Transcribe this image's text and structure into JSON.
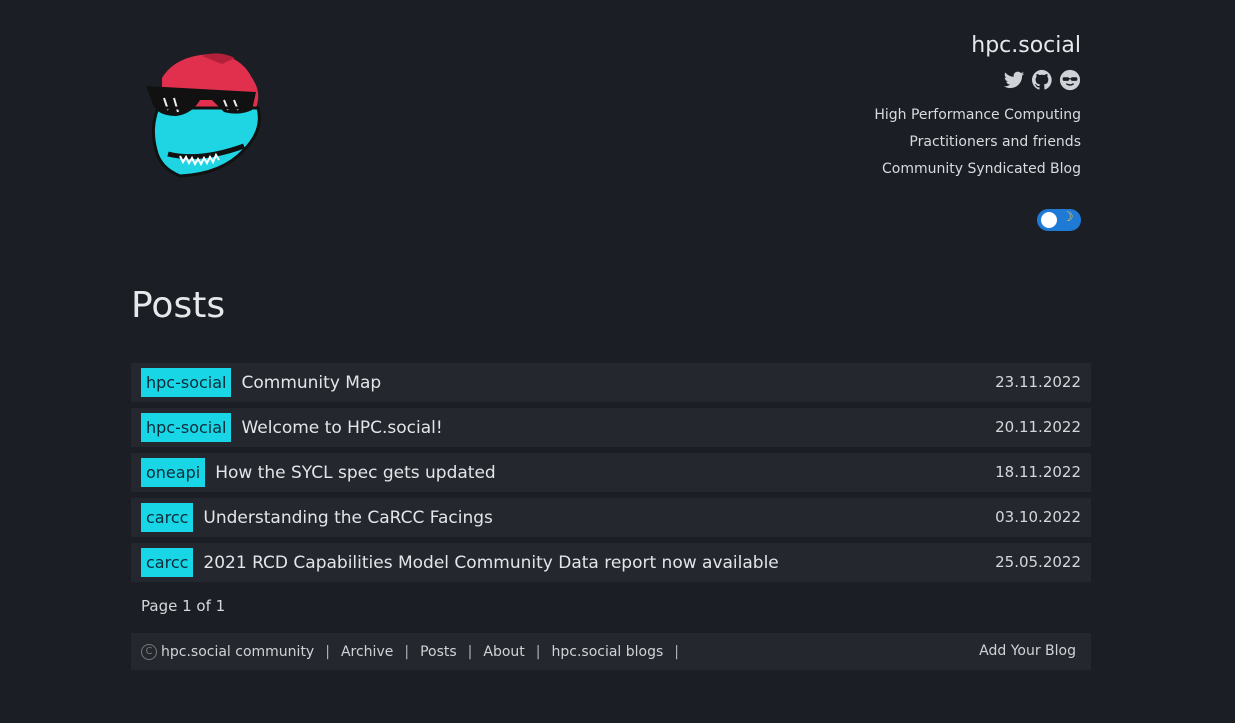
{
  "site": {
    "title": "hpc.social",
    "tagline": [
      "High Performance Computing",
      "Practitioners and friends",
      "Community Syndicated Blog"
    ],
    "social_icons": [
      "twitter-icon",
      "github-icon",
      "mastodon-icon"
    ],
    "toggle_icon": "moon-icon"
  },
  "main": {
    "heading": "Posts",
    "posts": [
      {
        "tag": "hpc-social",
        "title": "Community Map",
        "date": "23.11.2022"
      },
      {
        "tag": "hpc-social",
        "title": "Welcome to HPC.social!",
        "date": "20.11.2022"
      },
      {
        "tag": "oneapi",
        "title": "How the SYCL spec gets updated",
        "date": "18.11.2022"
      },
      {
        "tag": "carcc",
        "title": "Understanding the CaRCC Facings",
        "date": "03.10.2022"
      },
      {
        "tag": "carcc",
        "title": "2021 RCD Capabilities Model Community Data report now available",
        "date": "25.05.2022"
      }
    ],
    "pager": "Page 1 of 1"
  },
  "footer": {
    "copyright": "hpc.social community",
    "links": [
      "Archive",
      "Posts",
      "About",
      "hpc.social blogs"
    ],
    "add_blog": "Add Your Blog"
  },
  "colors": {
    "background": "#1b1e24",
    "row": "#24282e",
    "tag": "#18d6e6",
    "toggle": "#1f7ad6"
  }
}
